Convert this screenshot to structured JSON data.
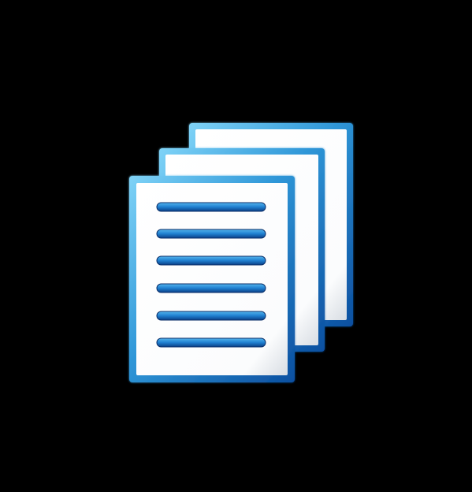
{
  "icon": {
    "name": "documents-stack-icon",
    "page_count": 3,
    "line_count": 6
  },
  "colors": {
    "background": "#000000",
    "frame_light": "#6cc8f2",
    "frame_mid": "#2a8fd2",
    "frame_dark": "#0d56a6",
    "paper": "#ffffff",
    "paper_shadow": "#d9dde2",
    "line_light": "#3fa8e6",
    "line_dark": "#0b3f86"
  }
}
